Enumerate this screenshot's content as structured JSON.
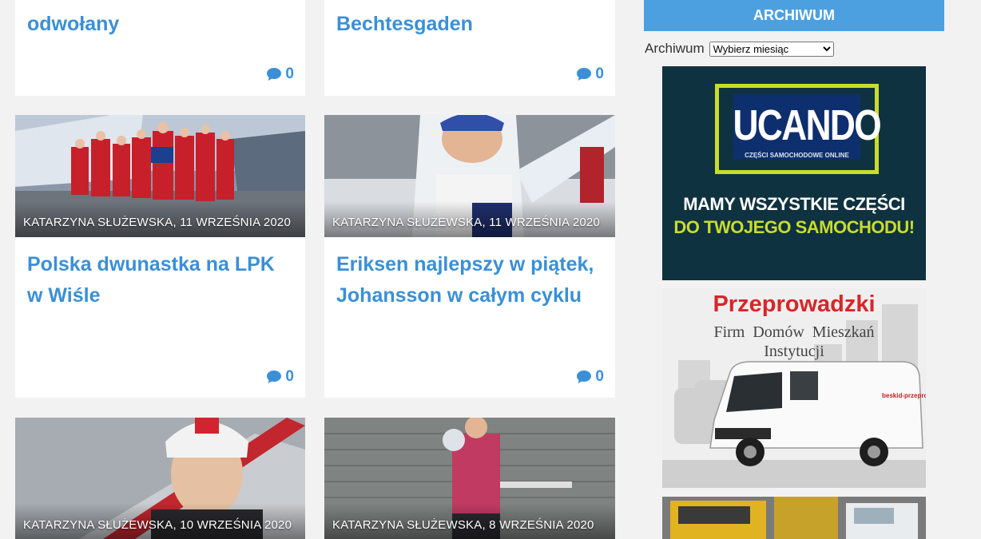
{
  "posts": [
    {
      "title_l1": "odwołany",
      "title_l2": "",
      "comments": "0",
      "meta": ""
    },
    {
      "title_l1": "Bechtesgaden",
      "title_l2": "",
      "comments": "0",
      "meta": ""
    },
    {
      "title_l1": "Polska dwunastka na LPK",
      "title_l2": "w Wiśle",
      "comments": "0",
      "meta": "KATARZYNA SŁUŻEWSKA, 11 WRZEŚNIA 2020"
    },
    {
      "title_l1": "Eriksen najlepszy w piątek,",
      "title_l2": "Johansson w całym cyklu",
      "comments": "0",
      "meta": "KATARZYNA SŁUŻEWSKA, 11 WRZEŚNIA 2020"
    },
    {
      "title_l1": "",
      "title_l2": "",
      "comments": "",
      "meta": "KATARZYNA SŁUŻEWSKA, 10 WRZEŚNIA 2020"
    },
    {
      "title_l1": "",
      "title_l2": "",
      "comments": "",
      "meta": "KATARZYNA SŁUŻEWSKA, 8 WRZEŚNIA 2020"
    }
  ],
  "sidebar": {
    "archive_header": "ARCHIWUM",
    "archive_label": "Archiwum",
    "archive_select": "Wybierz miesiąc"
  },
  "ads": {
    "ucando": {
      "logo": "UCANDO",
      "sub": "CZĘŚCI SAMOCHODOWE ONLINE",
      "line1": "MAMY WSZYSTKIE CZĘŚCI",
      "line2": "DO TWOJEGO SAMOCHODU!"
    },
    "moving": {
      "title": "Przeprowadzki",
      "line1": "Firm  Domów  Mieszkań",
      "line2": "Instytucji",
      "van_brand": "beskid-przeprowadz"
    }
  },
  "colors": {
    "accent": "#3b8fd6",
    "header": "#4da0e0"
  }
}
